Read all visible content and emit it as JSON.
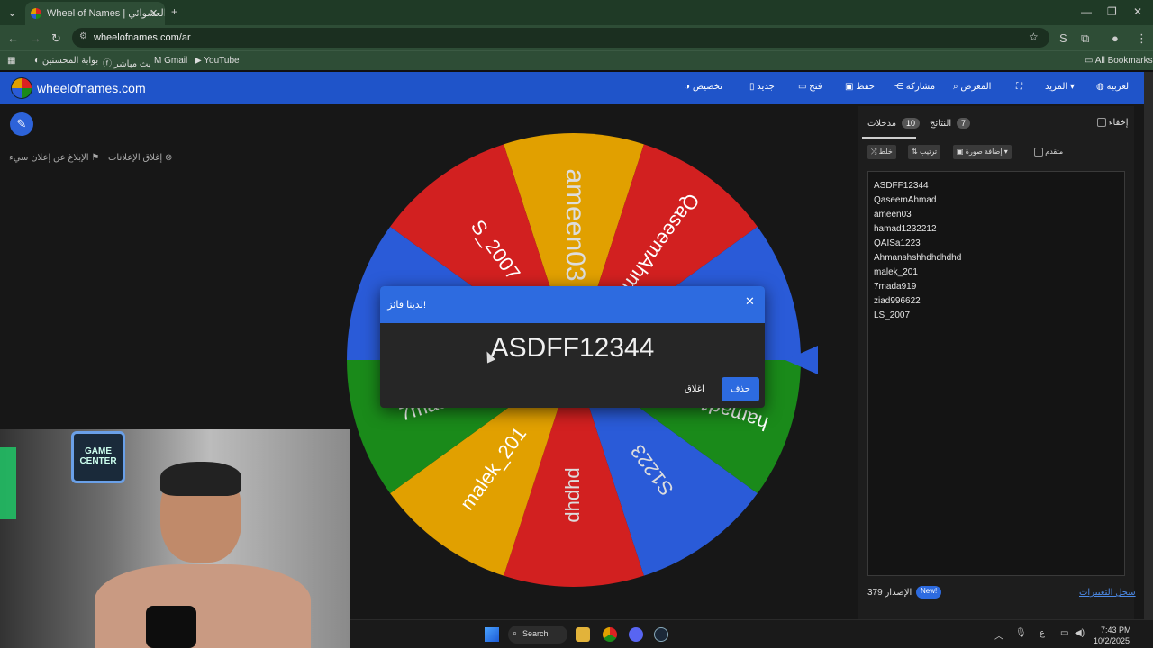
{
  "browser": {
    "tab_title": "Wheel of Names | العشوائي",
    "url": "wheelofnames.com/ar",
    "new_tab": "+",
    "bookmarks": [
      {
        "label": "بوابة المحسنين"
      },
      {
        "label": "بث مباشر"
      },
      {
        "label": "Gmail"
      },
      {
        "label": "YouTube"
      }
    ],
    "all_bookmarks": "All Bookmarks"
  },
  "site": {
    "brand": "wheelofnames.com",
    "nav": {
      "customize": "تخصيص",
      "new": "جديد",
      "open": "فتح",
      "save": "حفظ",
      "share": "مشاركة",
      "gallery": "المعرض",
      "more": "المزيد",
      "language": "العربية"
    },
    "ad_close": "إغلاق الإعلانات",
    "ad_report": "الإبلاغ عن إعلان سيء"
  },
  "wheel": {
    "colors": [
      "#2a5bd8",
      "#1a8a1a",
      "#e1a000",
      "#d22020"
    ],
    "visible_labels": [
      "ameen03",
      "QaseemAhmad",
      "344",
      "hamad1232212",
      "S1223",
      "dhdhd",
      "malek_201",
      "7mada919",
      "ziad996622",
      "S_2007"
    ]
  },
  "modal": {
    "title": "لدينا فائز!",
    "winner": "ASDFF12344",
    "close": "اغلاق",
    "remove": "حذف"
  },
  "panel": {
    "tabs": {
      "entries_label": "مدخلات",
      "entries_count": "10",
      "results_label": "النتائج",
      "results_count": "7"
    },
    "hide": "إخفاء",
    "shuffle": "خلط",
    "sort": "ترتيب",
    "add_image": "إضافة صورة",
    "advanced": "متقدم",
    "entries": [
      "ASDFF12344",
      "QaseemAhmad",
      "ameen03",
      "hamad1232212",
      "QAISa1223",
      "Ahmanshshhdhdhdhd",
      "malek_201",
      "7mada919",
      "ziad996622",
      "LS_2007"
    ],
    "version_label": "الإصدار",
    "version": "379",
    "new_badge": "New!",
    "changelog": "سجل التغييرات"
  },
  "webcam": {
    "sign": "GAME CENTER"
  },
  "taskbar": {
    "search": "Search",
    "lang": "ع",
    "time": "7:43 PM",
    "date": "10/2/2025"
  }
}
